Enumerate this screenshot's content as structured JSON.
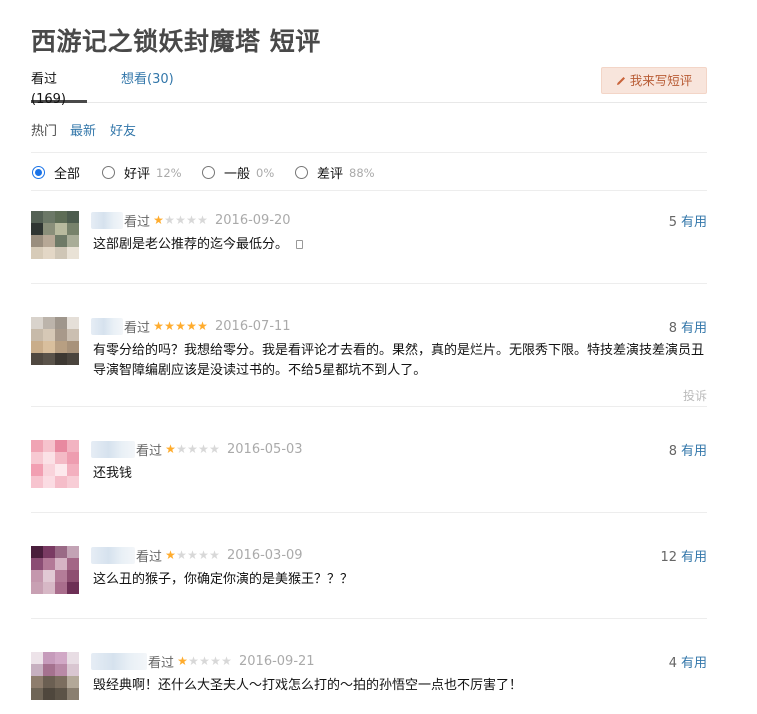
{
  "title": "西游记之锁妖封魔塔 短评",
  "tabs": [
    {
      "label": "看过(169)",
      "active": true
    },
    {
      "label": "想看(30)",
      "active": false
    }
  ],
  "write_button": "我来写短评",
  "sorts": [
    {
      "label": "热门",
      "active": true
    },
    {
      "label": "最新",
      "active": false
    },
    {
      "label": "好友",
      "active": false
    }
  ],
  "filters": [
    {
      "label": "全部",
      "pct": "",
      "checked": true
    },
    {
      "label": "好评",
      "pct": "12%",
      "checked": false
    },
    {
      "label": "一般",
      "pct": "0%",
      "checked": false
    },
    {
      "label": "差评",
      "pct": "88%",
      "checked": false
    }
  ],
  "comments": [
    {
      "status": "看过",
      "rating": 1,
      "date": "2016-09-20",
      "useful_count": "5",
      "useful_label": "有用",
      "text": "这部剧是老公推荐的迄今最低分。",
      "report": ""
    },
    {
      "status": "看过",
      "rating": 5,
      "date": "2016-07-11",
      "useful_count": "8",
      "useful_label": "有用",
      "text": "有零分给的吗？我想给零分。我是看评论才去看的。果然，真的是烂片。无限秀下限。特技差演技差演员丑导演智障编剧应该是没读过书的。不给5星都坑不到人了。",
      "report": "投诉"
    },
    {
      "status": "看过",
      "rating": 1,
      "date": "2016-05-03",
      "useful_count": "8",
      "useful_label": "有用",
      "text": "还我钱",
      "report": ""
    },
    {
      "status": "看过",
      "rating": 1,
      "date": "2016-03-09",
      "useful_count": "12",
      "useful_label": "有用",
      "text": "这么丑的猴子，你确定你演的是美猴王？？？",
      "report": ""
    },
    {
      "status": "看过",
      "rating": 1,
      "date": "2016-09-21",
      "useful_count": "4",
      "useful_label": "有用",
      "text": "毁经典啊！还什么大圣夫人～打戏怎么打的～拍的孙悟空一点也不厉害了！",
      "report": ""
    }
  ],
  "colors": {
    "link": "#3377aa",
    "star_filled": "#ffac2d",
    "star_empty": "#d8d8d8",
    "radio_checked": "#1a73e8",
    "write_button_bg": "#f8e5dc",
    "write_button_text": "#b85c35"
  },
  "icons": {
    "write_button": "pencil-icon",
    "star": "star-icon",
    "avatar": "pixelated-avatar"
  }
}
